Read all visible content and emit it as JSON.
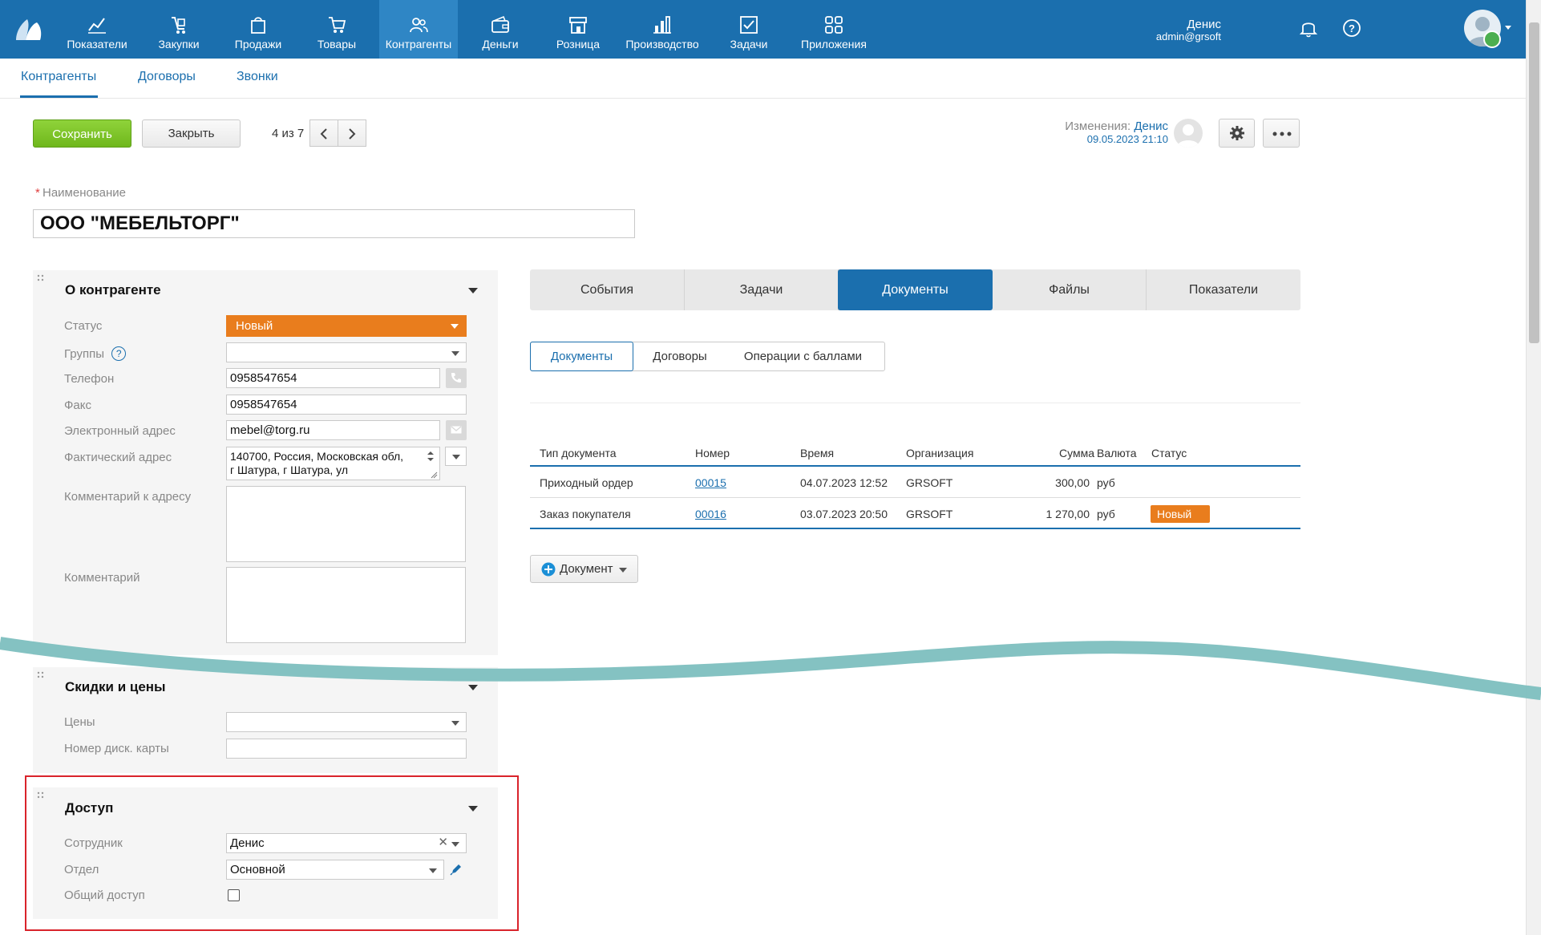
{
  "topnav": {
    "items": [
      {
        "label": "Показатели",
        "icon": "chart-icon"
      },
      {
        "label": "Закупки",
        "icon": "purchase-icon"
      },
      {
        "label": "Продажи",
        "icon": "bag-icon"
      },
      {
        "label": "Товары",
        "icon": "cart-icon"
      },
      {
        "label": "Контрагенты",
        "icon": "people-icon",
        "active": true
      },
      {
        "label": "Деньги",
        "icon": "wallet-icon"
      },
      {
        "label": "Розница",
        "icon": "store-icon"
      },
      {
        "label": "Производство",
        "icon": "factory-icon"
      },
      {
        "label": "Задачи",
        "icon": "task-icon"
      },
      {
        "label": "Приложения",
        "icon": "apps-icon"
      }
    ],
    "user_name": "Денис",
    "user_email": "admin@grsoft"
  },
  "subnav": {
    "tabs": [
      "Контрагенты",
      "Договоры",
      "Звонки"
    ]
  },
  "toolbar": {
    "save_label": "Сохранить",
    "close_label": "Закрыть",
    "pager": "4 из 7",
    "changes_label": "Изменения:",
    "changes_user": "Денис",
    "changes_date": "09.05.2023 21:10"
  },
  "name_field": {
    "required_mark": "*",
    "label": "Наименование",
    "value": "ООО \"МЕБЕЛЬТОРГ\""
  },
  "about": {
    "title": "О контрагенте",
    "status_label": "Статус",
    "status_value": "Новый",
    "groups_label": "Группы",
    "groups_help": "?",
    "phone_label": "Телефон",
    "phone_value": "0958547654",
    "fax_label": "Факс",
    "fax_value": "0958547654",
    "email_label": "Электронный адрес",
    "email_value": "mebel@torg.ru",
    "address_label": "Фактический адрес",
    "address_line1": "140700, Россия, Московская обл,",
    "address_line2": "г Шатура, г Шатура, ул",
    "address_comment_label": "Комментарий к адресу",
    "comment_label": "Комментарий"
  },
  "discounts": {
    "title": "Скидки и цены",
    "prices_label": "Цены",
    "card_label": "Номер диск. карты"
  },
  "access": {
    "title": "Доступ",
    "employee_label": "Сотрудник",
    "employee_value": "Денис",
    "department_label": "Отдел",
    "department_value": "Основной",
    "shared_label": "Общий доступ"
  },
  "right_tabs": [
    "События",
    "Задачи",
    "Документы",
    "Файлы",
    "Показатели"
  ],
  "doc_subtabs": [
    "Документы",
    "Договоры",
    "Операции с баллами"
  ],
  "table": {
    "headers": [
      "Тип документа",
      "Номер",
      "Время",
      "Организация",
      "Сумма",
      "Валюта",
      "Статус"
    ],
    "rows": [
      {
        "type": "Приходный ордер",
        "number": "00015",
        "time": "04.07.2023 12:52",
        "org": "GRSOFT",
        "sum": "300,00",
        "currency": "руб",
        "status": ""
      },
      {
        "type": "Заказ покупателя",
        "number": "00016",
        "time": "03.07.2023 20:50",
        "org": "GRSOFT",
        "sum": "1 270,00",
        "currency": "руб",
        "status": "Новый"
      }
    ]
  },
  "add_document_label": "Документ",
  "colors": {
    "brand": "#1b6fae",
    "save_green": "#7bc42a",
    "status_orange": "#e97d1d",
    "highlight_red": "#d9232b",
    "wave_teal": "#7dbfbf"
  }
}
